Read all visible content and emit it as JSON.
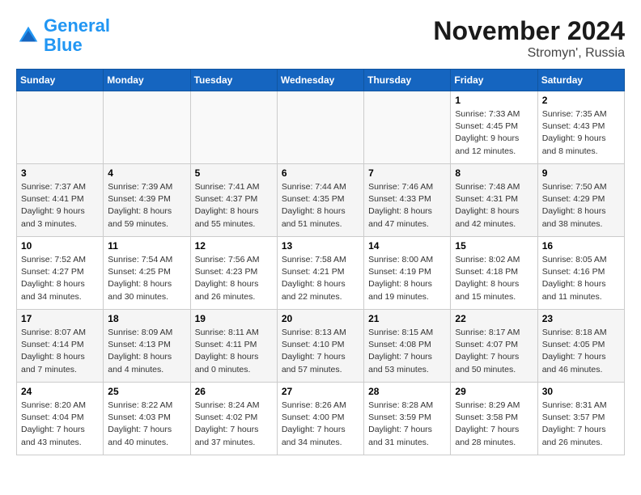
{
  "logo": {
    "line1": "General",
    "line2": "Blue"
  },
  "title": "November 2024",
  "location": "Stromyn', Russia",
  "days_of_week": [
    "Sunday",
    "Monday",
    "Tuesday",
    "Wednesday",
    "Thursday",
    "Friday",
    "Saturday"
  ],
  "weeks": [
    [
      {
        "day": "",
        "info": ""
      },
      {
        "day": "",
        "info": ""
      },
      {
        "day": "",
        "info": ""
      },
      {
        "day": "",
        "info": ""
      },
      {
        "day": "",
        "info": ""
      },
      {
        "day": "1",
        "info": "Sunrise: 7:33 AM\nSunset: 4:45 PM\nDaylight: 9 hours and 12 minutes."
      },
      {
        "day": "2",
        "info": "Sunrise: 7:35 AM\nSunset: 4:43 PM\nDaylight: 9 hours and 8 minutes."
      }
    ],
    [
      {
        "day": "3",
        "info": "Sunrise: 7:37 AM\nSunset: 4:41 PM\nDaylight: 9 hours and 3 minutes."
      },
      {
        "day": "4",
        "info": "Sunrise: 7:39 AM\nSunset: 4:39 PM\nDaylight: 8 hours and 59 minutes."
      },
      {
        "day": "5",
        "info": "Sunrise: 7:41 AM\nSunset: 4:37 PM\nDaylight: 8 hours and 55 minutes."
      },
      {
        "day": "6",
        "info": "Sunrise: 7:44 AM\nSunset: 4:35 PM\nDaylight: 8 hours and 51 minutes."
      },
      {
        "day": "7",
        "info": "Sunrise: 7:46 AM\nSunset: 4:33 PM\nDaylight: 8 hours and 47 minutes."
      },
      {
        "day": "8",
        "info": "Sunrise: 7:48 AM\nSunset: 4:31 PM\nDaylight: 8 hours and 42 minutes."
      },
      {
        "day": "9",
        "info": "Sunrise: 7:50 AM\nSunset: 4:29 PM\nDaylight: 8 hours and 38 minutes."
      }
    ],
    [
      {
        "day": "10",
        "info": "Sunrise: 7:52 AM\nSunset: 4:27 PM\nDaylight: 8 hours and 34 minutes."
      },
      {
        "day": "11",
        "info": "Sunrise: 7:54 AM\nSunset: 4:25 PM\nDaylight: 8 hours and 30 minutes."
      },
      {
        "day": "12",
        "info": "Sunrise: 7:56 AM\nSunset: 4:23 PM\nDaylight: 8 hours and 26 minutes."
      },
      {
        "day": "13",
        "info": "Sunrise: 7:58 AM\nSunset: 4:21 PM\nDaylight: 8 hours and 22 minutes."
      },
      {
        "day": "14",
        "info": "Sunrise: 8:00 AM\nSunset: 4:19 PM\nDaylight: 8 hours and 19 minutes."
      },
      {
        "day": "15",
        "info": "Sunrise: 8:02 AM\nSunset: 4:18 PM\nDaylight: 8 hours and 15 minutes."
      },
      {
        "day": "16",
        "info": "Sunrise: 8:05 AM\nSunset: 4:16 PM\nDaylight: 8 hours and 11 minutes."
      }
    ],
    [
      {
        "day": "17",
        "info": "Sunrise: 8:07 AM\nSunset: 4:14 PM\nDaylight: 8 hours and 7 minutes."
      },
      {
        "day": "18",
        "info": "Sunrise: 8:09 AM\nSunset: 4:13 PM\nDaylight: 8 hours and 4 minutes."
      },
      {
        "day": "19",
        "info": "Sunrise: 8:11 AM\nSunset: 4:11 PM\nDaylight: 8 hours and 0 minutes."
      },
      {
        "day": "20",
        "info": "Sunrise: 8:13 AM\nSunset: 4:10 PM\nDaylight: 7 hours and 57 minutes."
      },
      {
        "day": "21",
        "info": "Sunrise: 8:15 AM\nSunset: 4:08 PM\nDaylight: 7 hours and 53 minutes."
      },
      {
        "day": "22",
        "info": "Sunrise: 8:17 AM\nSunset: 4:07 PM\nDaylight: 7 hours and 50 minutes."
      },
      {
        "day": "23",
        "info": "Sunrise: 8:18 AM\nSunset: 4:05 PM\nDaylight: 7 hours and 46 minutes."
      }
    ],
    [
      {
        "day": "24",
        "info": "Sunrise: 8:20 AM\nSunset: 4:04 PM\nDaylight: 7 hours and 43 minutes."
      },
      {
        "day": "25",
        "info": "Sunrise: 8:22 AM\nSunset: 4:03 PM\nDaylight: 7 hours and 40 minutes."
      },
      {
        "day": "26",
        "info": "Sunrise: 8:24 AM\nSunset: 4:02 PM\nDaylight: 7 hours and 37 minutes."
      },
      {
        "day": "27",
        "info": "Sunrise: 8:26 AM\nSunset: 4:00 PM\nDaylight: 7 hours and 34 minutes."
      },
      {
        "day": "28",
        "info": "Sunrise: 8:28 AM\nSunset: 3:59 PM\nDaylight: 7 hours and 31 minutes."
      },
      {
        "day": "29",
        "info": "Sunrise: 8:29 AM\nSunset: 3:58 PM\nDaylight: 7 hours and 28 minutes."
      },
      {
        "day": "30",
        "info": "Sunrise: 8:31 AM\nSunset: 3:57 PM\nDaylight: 7 hours and 26 minutes."
      }
    ]
  ]
}
